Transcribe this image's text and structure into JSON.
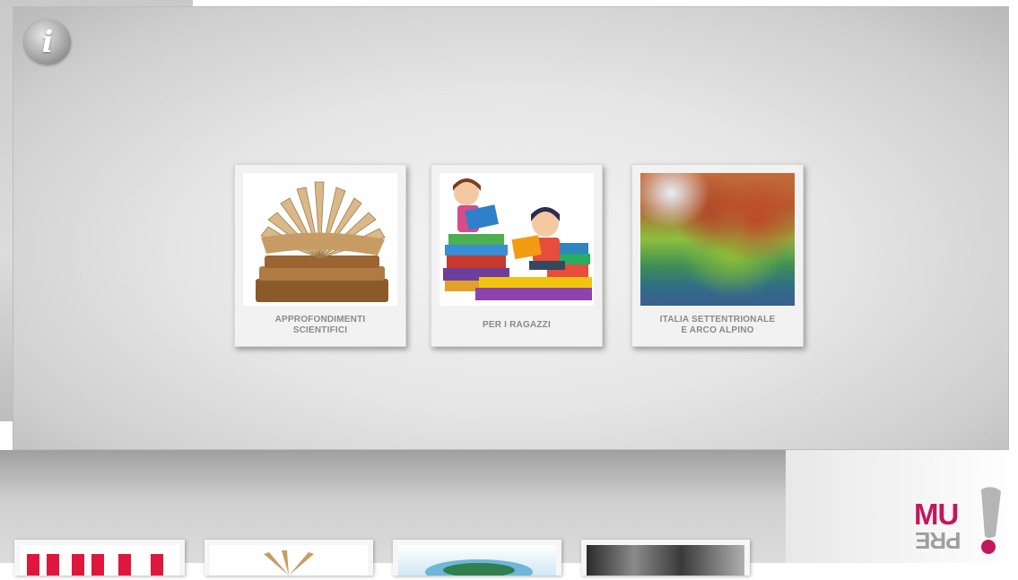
{
  "header": {
    "info_icon": "info-icon"
  },
  "tiles": [
    {
      "label": "APPROFONDIMENTI\nSCIENTIFICI",
      "image": "open-book-icon"
    },
    {
      "label": "PER I RAGAZZI",
      "image": "kids-reading-icon"
    },
    {
      "label": "ITALIA SETTENTRIONALE\nE ARCO ALPINO",
      "image": "relief-map-icon"
    }
  ],
  "logo": {
    "top": "MU",
    "bottom": "PRE"
  },
  "colors": {
    "brand": "#c2185b",
    "label": "#8a8a8a"
  }
}
